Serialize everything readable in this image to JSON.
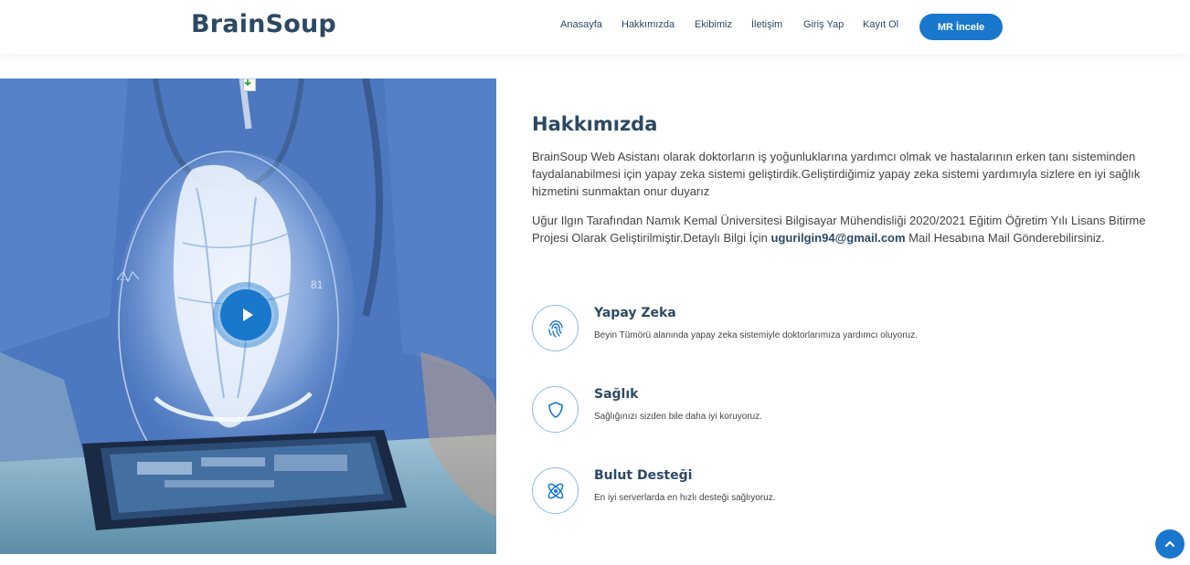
{
  "header": {
    "logo": "BrainSoup",
    "nav": [
      "Anasayfa",
      "Hakkımızda",
      "Ekibimiz",
      "İletişim",
      "Giriş Yap",
      "Kayıt Ol"
    ],
    "cta_label": "MR İncele"
  },
  "hero": {
    "readout_left": "·-·-·",
    "readout_right": "81"
  },
  "about": {
    "title": "Hakkımızda",
    "paragraph1": "BrainSoup Web Asistanı olarak doktorların iş yoğunluklarına yardımcı olmak ve hastalarının erken tanı sisteminden faydalanabilmesi için yapay zeka sistemi geliştirdik.Geliştirdiğimiz yapay zeka sistemi yardımıyla sizlere en iyi sağlık hizmetini sunmaktan onur duyarız",
    "paragraph2_before": "Uğur Ilgın Tarafından Namık Kemal Üniversitesi Bilgisayar Mühendisliği 2020/2021 Eğitim Öğretim Yılı Lisans Bitirme Projesi Olarak Geliştirilmiştir.Detaylı Bilgi İçin ",
    "paragraph2_email": "ugurilgin94@gmail.com",
    "paragraph2_after": " Mail Hesabına Mail Gönderebilirsiniz.",
    "features": [
      {
        "icon": "fingerprint-icon",
        "title": "Yapay Zeka",
        "description": "Beyin Tümörü alanında yapay zeka sistemiyle doktorlarımıza yardımcı oluyoruz."
      },
      {
        "icon": "shield-icon",
        "title": "Sağlık",
        "description": "Sağlığınızı sizden bile daha iyi koruyoruz."
      },
      {
        "icon": "atom-icon",
        "title": "Bulut Desteği",
        "description": "En iyi serverlarda en hızlı desteği sağlıyoruz."
      }
    ]
  },
  "colors": {
    "primary": "#1977cc",
    "heading": "#2c4964",
    "text": "#444444"
  }
}
